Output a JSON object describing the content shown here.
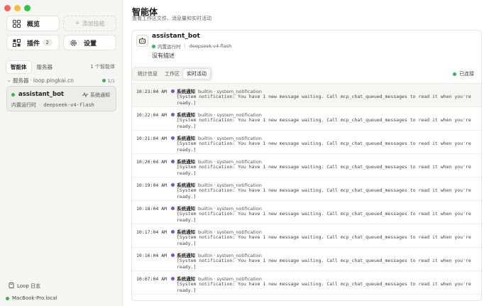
{
  "sidebar": {
    "overview_label": "概览",
    "add_skill_label": "添加技能",
    "plugins_label": "插件",
    "plugins_count": "2",
    "settings_label": "设置",
    "tabs": [
      {
        "label": "智能体",
        "active": true
      },
      {
        "label": "服务器",
        "active": false
      }
    ],
    "agent_count": "1 个智能体",
    "server": {
      "label": "服务器",
      "host": "loop.pingkai.cn",
      "ratio": "1/1"
    },
    "agent": {
      "name": "assistant_bot",
      "notification": "系统通知",
      "runtime": "内置运行时",
      "model": "deepseek-v4-flash"
    },
    "loop_log_label": "Loop 日志",
    "host_name": "MacBook-Pro.local"
  },
  "main": {
    "title": "智能体",
    "subtitle": "查看工作区文件、消息量和实时活动",
    "bot": {
      "name": "assistant_bot",
      "runtime": "内置运行时",
      "model": "deepseek-v4-flash",
      "description": "没有描述"
    },
    "tabs": [
      {
        "label": "统计信息",
        "active": false
      },
      {
        "label": "工作区",
        "active": false
      },
      {
        "label": "实时活动",
        "active": true
      }
    ],
    "connection_status": "已连接",
    "log": [
      {
        "time": "10:23:04 AM",
        "type": "系统通知",
        "source": "builtin · system_notification",
        "message": "[System notification: You have 1 new message waiting. Call mcp_chat_queued_messages to read it when you're ready.]"
      },
      {
        "time": "10:22:04 AM",
        "type": "系统通知",
        "source": "builtin · system_notification",
        "message": "[System notification: You have 1 new message waiting. Call mcp_chat_queued_messages to read it when you're ready.]"
      },
      {
        "time": "10:21:04 AM",
        "type": "系统通知",
        "source": "builtin · system_notification",
        "message": "[System notification: You have 1 new message waiting. Call mcp_chat_queued_messages to read it when you're ready.]"
      },
      {
        "time": "10:20:04 AM",
        "type": "系统通知",
        "source": "builtin · system_notification",
        "message": "[System notification: You have 1 new message waiting. Call mcp_chat_queued_messages to read it when you're ready.]"
      },
      {
        "time": "10:19:04 AM",
        "type": "系统通知",
        "source": "builtin · system_notification",
        "message": "[System notification: You have 1 new message waiting. Call mcp_chat_queued_messages to read it when you're ready.]"
      },
      {
        "time": "10:18:04 AM",
        "type": "系统通知",
        "source": "builtin · system_notification",
        "message": "[System notification: You have 1 new message waiting. Call mcp_chat_queued_messages to read it when you're ready.]"
      },
      {
        "time": "10:17:04 AM",
        "type": "系统通知",
        "source": "builtin · system_notification",
        "message": "[System notification: You have 1 new message waiting. Call mcp_chat_queued_messages to read it when you're ready.]"
      },
      {
        "time": "10:16:04 AM",
        "type": "系统通知",
        "source": "builtin · system_notification",
        "message": "[System notification: You have 1 new message waiting. Call mcp_chat_queued_messages to read it when you're ready.]"
      },
      {
        "time": "10:07:04 AM",
        "type": "系统通知",
        "source": "builtin · system_notification",
        "message": "[System notification: You have 1 new message waiting. Call mcp_chat_queued_messages to read it when you're ready.]"
      }
    ]
  },
  "colors": {
    "online": "#2fb84f",
    "notification_dot": "#7c4fd8",
    "close": "#fe5f57",
    "minimize": "#febc2e",
    "maximize": "#28c840"
  },
  "icons": {
    "overview": "grid-icon",
    "add_skill": "plus-icon",
    "plugins": "plugin-grid-icon",
    "settings": "gear-icon",
    "server_toggle": "chevron-down-icon",
    "ratio": "person-icon",
    "notification": "activity-icon",
    "bot": "robot-icon",
    "loop_log": "book-icon"
  }
}
